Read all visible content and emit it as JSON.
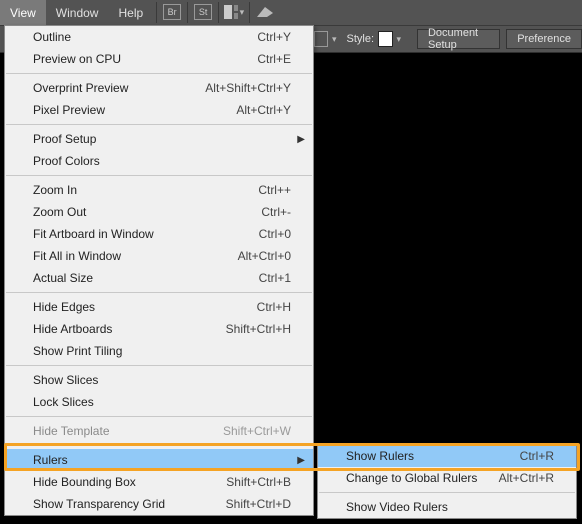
{
  "menubar": {
    "view": "View",
    "window": "Window",
    "help": "Help",
    "br": "Br",
    "st": "St"
  },
  "toolbar": {
    "style_label": "Style:",
    "doc_setup": "Document Setup",
    "preferences": "Preference"
  },
  "view_menu": [
    {
      "type": "item",
      "label": "Outline",
      "shortcut": "Ctrl+Y"
    },
    {
      "type": "item",
      "label": "Preview on CPU",
      "shortcut": "Ctrl+E"
    },
    {
      "type": "sep"
    },
    {
      "type": "item",
      "label": "Overprint Preview",
      "shortcut": "Alt+Shift+Ctrl+Y"
    },
    {
      "type": "item",
      "label": "Pixel Preview",
      "shortcut": "Alt+Ctrl+Y"
    },
    {
      "type": "sep"
    },
    {
      "type": "item",
      "label": "Proof Setup",
      "submenu": true
    },
    {
      "type": "item",
      "label": "Proof Colors"
    },
    {
      "type": "sep"
    },
    {
      "type": "item",
      "label": "Zoom In",
      "shortcut": "Ctrl++"
    },
    {
      "type": "item",
      "label": "Zoom Out",
      "shortcut": "Ctrl+-"
    },
    {
      "type": "item",
      "label": "Fit Artboard in Window",
      "shortcut": "Ctrl+0"
    },
    {
      "type": "item",
      "label": "Fit All in Window",
      "shortcut": "Alt+Ctrl+0"
    },
    {
      "type": "item",
      "label": "Actual Size",
      "shortcut": "Ctrl+1"
    },
    {
      "type": "sep"
    },
    {
      "type": "item",
      "label": "Hide Edges",
      "shortcut": "Ctrl+H"
    },
    {
      "type": "item",
      "label": "Hide Artboards",
      "shortcut": "Shift+Ctrl+H"
    },
    {
      "type": "item",
      "label": "Show Print Tiling"
    },
    {
      "type": "sep"
    },
    {
      "type": "item",
      "label": "Show Slices"
    },
    {
      "type": "item",
      "label": "Lock Slices"
    },
    {
      "type": "sep"
    },
    {
      "type": "item",
      "label": "Hide Template",
      "shortcut": "Shift+Ctrl+W",
      "disabled": true
    },
    {
      "type": "sep"
    },
    {
      "type": "item",
      "label": "Rulers",
      "submenu": true,
      "highlight": true
    },
    {
      "type": "item",
      "label": "Hide Bounding Box",
      "shortcut": "Shift+Ctrl+B"
    },
    {
      "type": "item",
      "label": "Show Transparency Grid",
      "shortcut": "Shift+Ctrl+D"
    }
  ],
  "rulers_submenu": [
    {
      "type": "item",
      "label": "Show Rulers",
      "shortcut": "Ctrl+R",
      "highlight": true
    },
    {
      "type": "item",
      "label": "Change to Global Rulers",
      "shortcut": "Alt+Ctrl+R"
    },
    {
      "type": "sep"
    },
    {
      "type": "item",
      "label": "Show Video Rulers"
    }
  ]
}
